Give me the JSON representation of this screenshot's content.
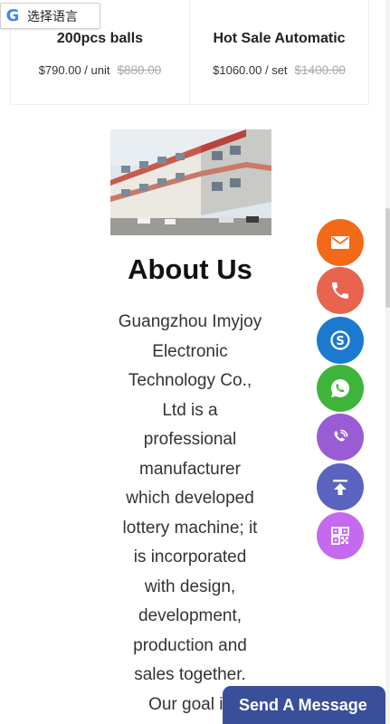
{
  "translate": {
    "logo": "G",
    "label": "选择语言"
  },
  "products": [
    {
      "name": "200pcs balls",
      "price": "$790.00 / unit",
      "old_price": "$880.00"
    },
    {
      "name": "Hot Sale Automatic",
      "price": "$1060.00 / set",
      "old_price": "$1400.00"
    }
  ],
  "about": {
    "title": "About Us",
    "text": "Guangzhou Imyjoy\nElectronic\nTechnology Co.,\nLtd is a\nprofessional\nmanufacturer\nwhich developed\nlottery machine; it\nis incorporated\nwith design,\ndevelopment,\nproduction and\nsales together.\nOur goal is"
  },
  "contact_buttons": [
    {
      "name": "email",
      "icon": "envelope-icon",
      "color": "#F26A17"
    },
    {
      "name": "phone",
      "icon": "phone-icon",
      "color": "#E8644E"
    },
    {
      "name": "skype",
      "icon": "skype-icon",
      "color": "#1B7ACF"
    },
    {
      "name": "whatsapp",
      "icon": "whatsapp-icon",
      "color": "#3FB43B"
    },
    {
      "name": "viber",
      "icon": "viber-icon",
      "color": "#9A5CD4"
    },
    {
      "name": "back-to-top",
      "icon": "arrow-up-icon",
      "color": "#5A63BE"
    },
    {
      "name": "qr-code",
      "icon": "qr-code-icon",
      "color": "#C569EE"
    }
  ],
  "send_message": {
    "label": "Send A Message",
    "color": "#3A4F9A"
  }
}
